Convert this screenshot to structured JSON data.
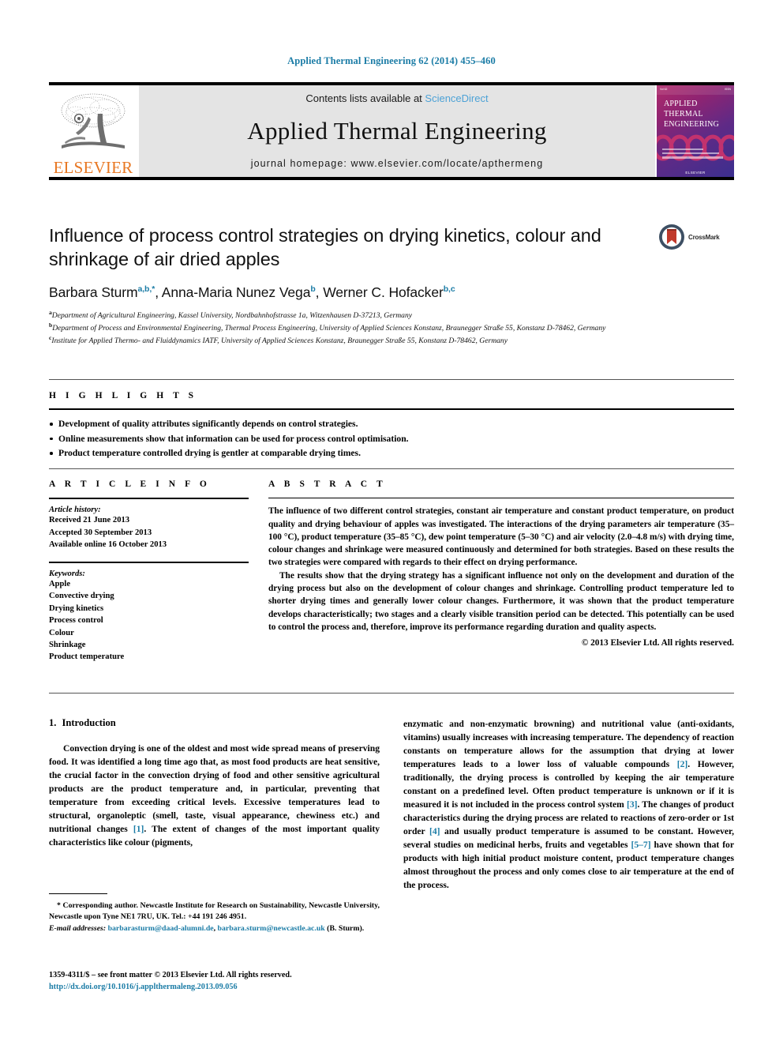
{
  "running_head": "Applied Thermal Engineering 62 (2014) 455–460",
  "masthead": {
    "contents_prefix": "Contents lists available at ",
    "sciencedirect": "ScienceDirect",
    "journal_name": "Applied Thermal Engineering",
    "homepage": "journal homepage: www.elsevier.com/locate/apthermeng",
    "publisher_logo_text": "ELSEVIER",
    "cover": {
      "line1": "APPLIED",
      "line2": "THERMAL",
      "line3": "ENGINEERING",
      "brand": "ELSEVIER"
    }
  },
  "title": "Influence of process control strategies on drying kinetics, colour and shrinkage of air dried apples",
  "crossmark_label": "CrossMark",
  "authors": [
    {
      "name": "Barbara Sturm",
      "marks": "a,b,*",
      "sep": ", "
    },
    {
      "name": "Anna-Maria Nunez Vega",
      "marks": "b",
      "sep": ", "
    },
    {
      "name": "Werner C. Hofacker",
      "marks": "b,c",
      "sep": ""
    }
  ],
  "affiliations": [
    {
      "mark": "a",
      "text": "Department of Agricultural Engineering, Kassel University, Nordbahnhofstrasse 1a, Witzenhausen D-37213, Germany"
    },
    {
      "mark": "b",
      "text": "Department of Process and Environmental Engineering, Thermal Process Engineering, University of Applied Sciences Konstanz, Braunegger Straße 55, Konstanz D-78462, Germany"
    },
    {
      "mark": "c",
      "text": "Institute for Applied Thermo- and Fluiddynamics IATF, University of Applied Sciences Konstanz, Braunegger Straße 55, Konstanz D-78462, Germany"
    }
  ],
  "highlights": {
    "heading": "H I G H L I G H T S",
    "items": [
      "Development of quality attributes significantly depends on control strategies.",
      "Online measurements show that information can be used for process control optimisation.",
      "Product temperature controlled drying is gentler at comparable drying times."
    ]
  },
  "article_info": {
    "heading": "A R T I C L E   I N F O",
    "history_label": "Article history:",
    "history": [
      "Received 21 June 2013",
      "Accepted 30 September 2013",
      "Available online 16 October 2013"
    ],
    "keywords_label": "Keywords:",
    "keywords": [
      "Apple",
      "Convective drying",
      "Drying kinetics",
      "Process control",
      "Colour",
      "Shrinkage",
      "Product temperature"
    ]
  },
  "abstract": {
    "heading": "A B S T R A C T",
    "paragraph1": "The influence of two different control strategies, constant air temperature and constant product temperature, on product quality and drying behaviour of apples was investigated. The interactions of the drying parameters air temperature (35–100 °C), product temperature (35–85 °C), dew point temperature (5–30 °C) and air velocity (2.0–4.8 m/s) with drying time, colour changes and shrinkage were measured continuously and determined for both strategies. Based on these results the two strategies were compared with regards to their effect on drying performance.",
    "paragraph2": "The results show that the drying strategy has a significant influence not only on the development and duration of the drying process but also on the development of colour changes and shrinkage. Controlling product temperature led to shorter drying times and generally lower colour changes. Furthermore, it was shown that the product temperature develops characteristically; two stages and a clearly visible transition period can be detected. This potentially can be used to control the process and, therefore, improve its performance regarding duration and quality aspects.",
    "copyright": "© 2013 Elsevier Ltd. All rights reserved."
  },
  "introduction": {
    "number": "1.",
    "heading": "Introduction",
    "left_paragraph_a": "Convection drying is one of the oldest and most wide spread means of preserving food. It was identified a long time ago that, as most food products are heat sensitive, the crucial factor in the convection drying of food and other sensitive agricultural products are the product temperature and, in particular, preventing that temperature from exceeding critical levels. Excessive temperatures lead to structural, organoleptic (smell, taste, visual appearance, chewiness etc.) and nutritional changes ",
    "ref1": "[1]",
    "left_paragraph_b": ". The extent of changes of the most important quality characteristics like colour (pigments,",
    "right_part_a": "enzymatic and non-enzymatic browning) and nutritional value (anti-oxidants, vitamins) usually increases with increasing temperature. The dependency of reaction constants on temperature allows for the assumption that drying at lower temperatures leads to a lower loss of valuable compounds ",
    "ref2": "[2]",
    "right_part_b": ". However, traditionally, the drying process is controlled by keeping the air temperature constant on a predefined level. Often product temperature is unknown or if it is measured it is not included in the process control system ",
    "ref3": "[3]",
    "right_part_c": ". The changes of product characteristics during the drying process are related to reactions of zero-order or 1st order ",
    "ref4": "[4]",
    "right_part_d": " and usually product temperature is assumed to be constant. However, several studies on medicinal herbs, fruits and vegetables ",
    "ref57": "[5–7]",
    "right_part_e": " have shown that for products with high initial product moisture content, product temperature changes almost throughout the process and only comes close to air temperature at the end of the process."
  },
  "footnote": {
    "corresponding": "* Corresponding author. Newcastle Institute for Research on Sustainability, Newcastle University, Newcastle upon Tyne NE1 7RU, UK. Tel.: +44 191 246 4951.",
    "email_label": "E-mail addresses:",
    "email1": "barbarasturm@daad-alumni.de",
    "email_sep": ", ",
    "email2": "barbara.sturm@newcastle.ac.uk",
    "email_attrib": " (B. Sturm)."
  },
  "issn_block": {
    "line1": "1359-4311/$ – see front matter © 2013 Elsevier Ltd. All rights reserved.",
    "doi": "http://dx.doi.org/10.1016/j.applthermaleng.2013.09.056"
  },
  "colors": {
    "link": "#1b7ca6",
    "sciencedirect": "#4da2d6",
    "elsevier_orange": "#e87722",
    "band_gray": "#e4e4e4"
  }
}
